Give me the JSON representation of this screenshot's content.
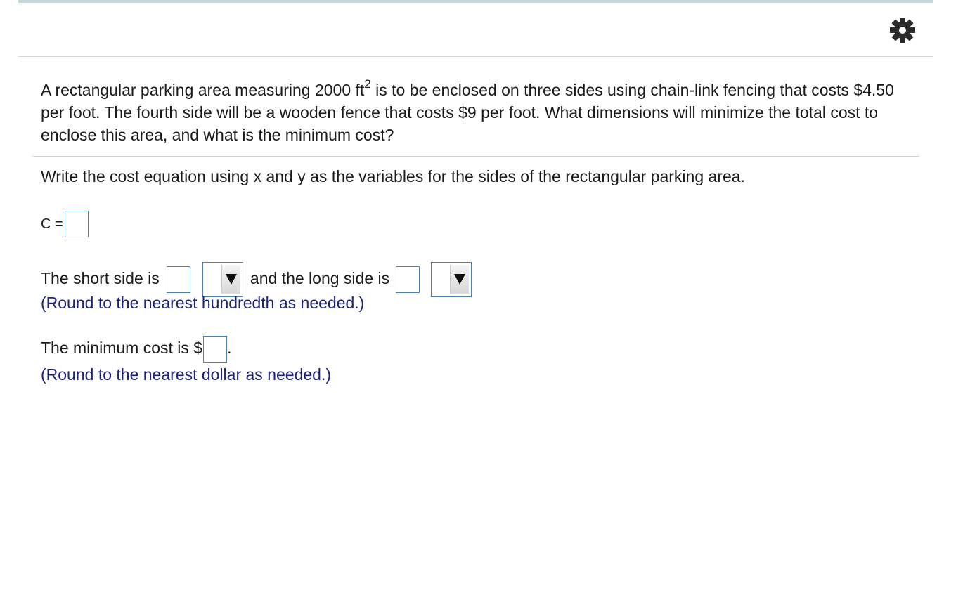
{
  "header": {
    "settings_icon": "gear-icon"
  },
  "question": {
    "text_before_sup": "A rectangular parking area measuring 2000 ft",
    "sup": "2",
    "text_after_sup": " is to be enclosed on three sides using chain-link fencing that costs $4.50 per foot. The fourth side will be a wooden fence that costs $9 per foot. What dimensions will minimize the total cost to enclose this area, and what is the minimum cost?"
  },
  "parts": {
    "instruction": "Write the cost equation using x and y as the variables for the sides of the rectangular parking area.",
    "cost_label": "C =",
    "short_side_label": "The short side is",
    "long_side_label": "and the long side is",
    "round_hundredth": "(Round to the nearest hundredth as needed.)",
    "min_cost_label": "The minimum cost is $",
    "min_cost_period": ".",
    "round_dollar": "(Round to the nearest dollar as needed.)"
  },
  "colors": {
    "hint_text": "#1a237e",
    "input_border": "#4a7fc1",
    "rule": "#d4d4dc",
    "top_bar": "#c7d8dc"
  }
}
